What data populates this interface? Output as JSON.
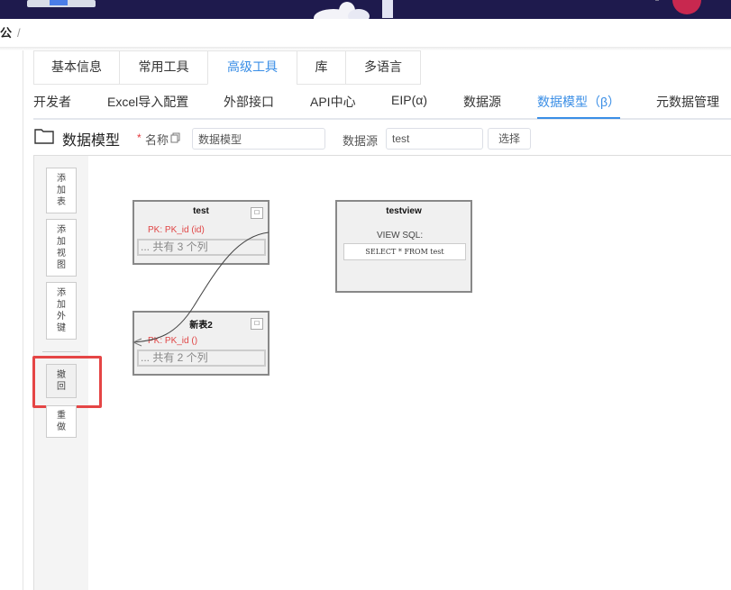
{
  "breadcrumb": {
    "current": "公",
    "sep": "/"
  },
  "tabs_primary": [
    {
      "label": "基本信息",
      "active": false
    },
    {
      "label": "常用工具",
      "active": false
    },
    {
      "label": "高级工具",
      "active": true
    },
    {
      "label": "库",
      "active": false
    },
    {
      "label": "多语言",
      "active": false
    }
  ],
  "tabs_secondary": [
    {
      "label": "开发者",
      "active": false
    },
    {
      "label": "Excel导入配置",
      "active": false
    },
    {
      "label": "外部接口",
      "active": false
    },
    {
      "label": "API中心",
      "active": false
    },
    {
      "label": "EIP(α)",
      "active": false
    },
    {
      "label": "数据源",
      "active": false
    },
    {
      "label": "数据模型（β）",
      "active": true
    },
    {
      "label": "元数据管理",
      "active": false
    }
  ],
  "header": {
    "title": "数据模型",
    "required_mark": "*",
    "name_label": "名称",
    "name_value": "数据模型",
    "datasource_label": "数据源",
    "datasource_value": "test",
    "select_button": "选择"
  },
  "toolbar": [
    {
      "chars": [
        "添",
        "加",
        "表"
      ]
    },
    {
      "chars": [
        "添",
        "加",
        "视",
        "图"
      ]
    },
    {
      "chars": [
        "添",
        "加",
        "外",
        "键"
      ]
    },
    {
      "chars": [
        "撤",
        "回"
      ]
    },
    {
      "chars": [
        "重",
        "做"
      ]
    }
  ],
  "tables": {
    "test": {
      "title": "test",
      "pk": "PK: PK_id (id)",
      "columns_summary": "... 共有 3 个列",
      "btn": "□"
    },
    "new": {
      "title": "新表2",
      "pk": "PK: PK_id ()",
      "columns_summary": "... 共有 2 个列",
      "btn": "□"
    }
  },
  "view": {
    "title": "testview",
    "sql_label": "VIEW SQL:",
    "sql": "SELECT * FROM test"
  },
  "colors": {
    "accent": "#3a8ee6",
    "highlight": "#e54545",
    "pk": "#e04545",
    "banner": "#1e1a4d"
  }
}
